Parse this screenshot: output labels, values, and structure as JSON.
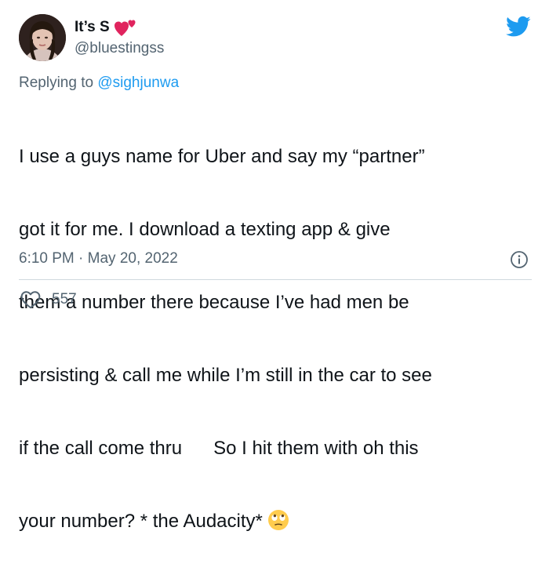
{
  "author": {
    "display_name": "It’s S",
    "handle": "@bluestingss",
    "avatar_icon": "profile-photo"
  },
  "reply": {
    "prefix": "Replying to ",
    "to_handle": "@sighjunwa"
  },
  "tweet": {
    "lines": [
      "I use a guys name for Uber and say my “partner”",
      "got it for me. I download a texting app & give",
      "them a number there because I’ve had men be",
      "persisting & call me while I’m still in the car to see",
      "if the call come thru      So I hit them with oh this",
      "your number? * the Audacity*"
    ],
    "trailing_emoji": "face-with-rolling-eyes-emoji"
  },
  "meta": {
    "timestamp": "6:10 PM · May 20, 2022"
  },
  "stats": {
    "likes": "557"
  },
  "colors": {
    "text": "#0f1419",
    "secondary": "#536471",
    "link": "#1d9bf0",
    "twitter_blue": "#1d9bf0",
    "hearts": "#e0245e",
    "divider": "#cfd9de"
  },
  "icons": [
    "twitter-bird-icon",
    "two-hearts-icon",
    "info-icon",
    "heart-outline-icon",
    "face-with-rolling-eyes-emoji"
  ]
}
